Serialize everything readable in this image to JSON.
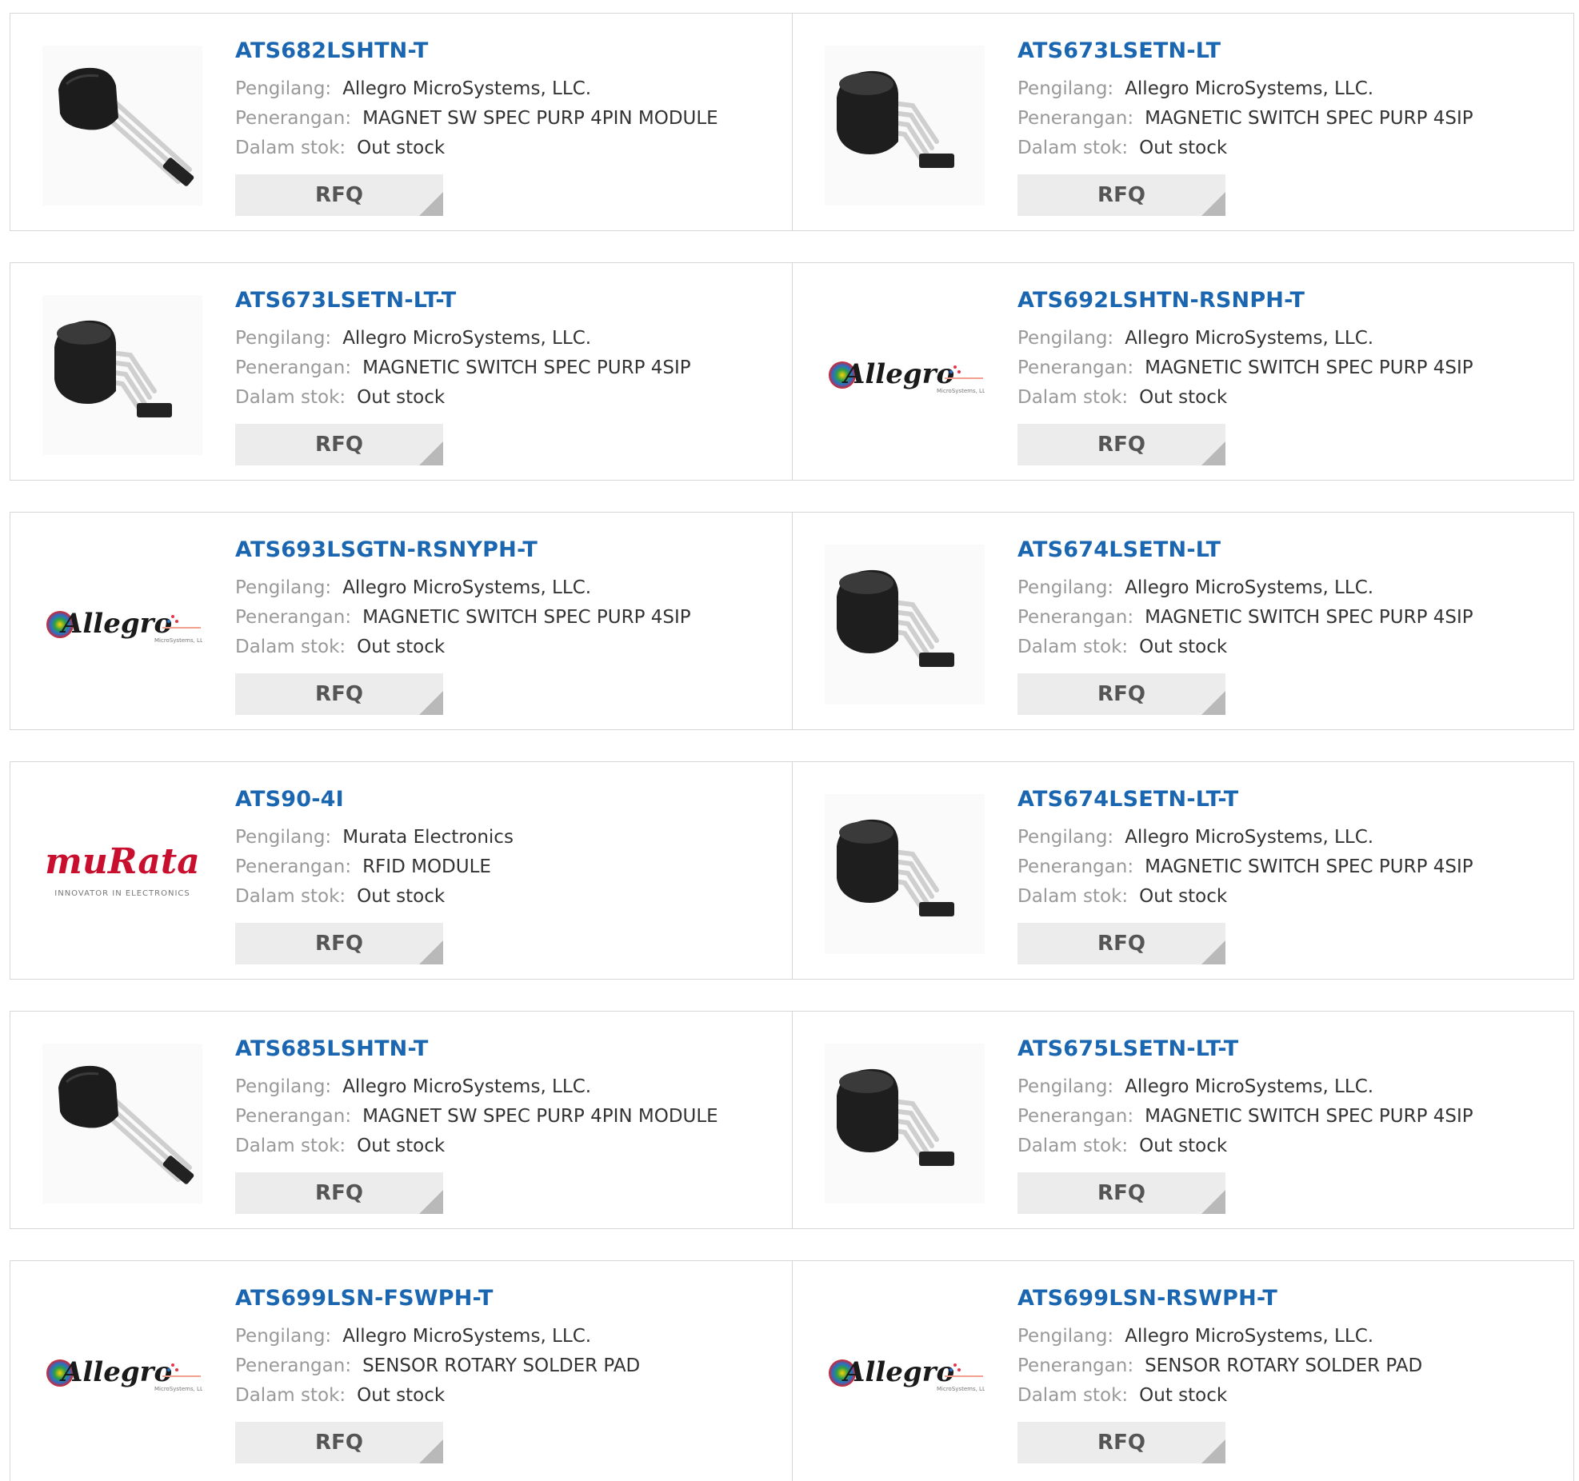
{
  "labels": {
    "manufacturer": "Pengilang:",
    "description": "Penerangan:",
    "stock": "Dalam stok:",
    "rfq": "RFQ"
  },
  "products": [
    {
      "part": "ATS682LSHTN-T",
      "manufacturer": "Allegro MicroSystems, LLC.",
      "description": "MAGNET SW SPEC PURP 4PIN MODULE",
      "stock": "Out stock",
      "image": "module-sensor-icon"
    },
    {
      "part": "ATS673LSETN-LT",
      "manufacturer": "Allegro MicroSystems, LLC.",
      "description": "MAGNETIC SWITCH SPEC PURP 4SIP",
      "stock": "Out stock",
      "image": "sip-sensor-icon"
    },
    {
      "part": "ATS673LSETN-LT-T",
      "manufacturer": "Allegro MicroSystems, LLC.",
      "description": "MAGNETIC SWITCH SPEC PURP 4SIP",
      "stock": "Out stock",
      "image": "sip-sensor-icon"
    },
    {
      "part": "ATS692LSHTN-RSNPH-T",
      "manufacturer": "Allegro MicroSystems, LLC.",
      "description": "MAGNETIC SWITCH SPEC PURP 4SIP",
      "stock": "Out stock",
      "image": "allegro-logo"
    },
    {
      "part": "ATS693LSGTN-RSNYPH-T",
      "manufacturer": "Allegro MicroSystems, LLC.",
      "description": "MAGNETIC SWITCH SPEC PURP 4SIP",
      "stock": "Out stock",
      "image": "allegro-logo"
    },
    {
      "part": "ATS674LSETN-LT",
      "manufacturer": "Allegro MicroSystems, LLC.",
      "description": "MAGNETIC SWITCH SPEC PURP 4SIP",
      "stock": "Out stock",
      "image": "sip-sensor-icon"
    },
    {
      "part": "ATS90-4I",
      "manufacturer": "Murata Electronics",
      "description": "RFID MODULE",
      "stock": "Out stock",
      "image": "murata-logo"
    },
    {
      "part": "ATS674LSETN-LT-T",
      "manufacturer": "Allegro MicroSystems, LLC.",
      "description": "MAGNETIC SWITCH SPEC PURP 4SIP",
      "stock": "Out stock",
      "image": "sip-sensor-icon"
    },
    {
      "part": "ATS685LSHTN-T",
      "manufacturer": "Allegro MicroSystems, LLC.",
      "description": "MAGNET SW SPEC PURP 4PIN MODULE",
      "stock": "Out stock",
      "image": "module-sensor-icon"
    },
    {
      "part": "ATS675LSETN-LT-T",
      "manufacturer": "Allegro MicroSystems, LLC.",
      "description": "MAGNETIC SWITCH SPEC PURP 4SIP",
      "stock": "Out stock",
      "image": "sip-sensor-icon"
    },
    {
      "part": "ATS699LSN-FSWPH-T",
      "manufacturer": "Allegro MicroSystems, LLC.",
      "description": "SENSOR ROTARY SOLDER PAD",
      "stock": "Out stock",
      "image": "allegro-logo"
    },
    {
      "part": "ATS699LSN-RSWPH-T",
      "manufacturer": "Allegro MicroSystems, LLC.",
      "description": "SENSOR ROTARY SOLDER PAD",
      "stock": "Out stock",
      "image": "allegro-logo"
    }
  ],
  "logos": {
    "allegro": {
      "wordmark": "Allegro",
      "sub": "MicroSystems, LLC"
    },
    "murata": {
      "wordmark": "muRata",
      "tagline": "INNOVATOR IN ELECTRONICS"
    }
  },
  "colors": {
    "part_link": "#1b66b1",
    "label": "#999999",
    "value": "#333333",
    "rfq_bg": "#ececec",
    "border": "#d6d6d6",
    "murata_red": "#c8102e"
  }
}
